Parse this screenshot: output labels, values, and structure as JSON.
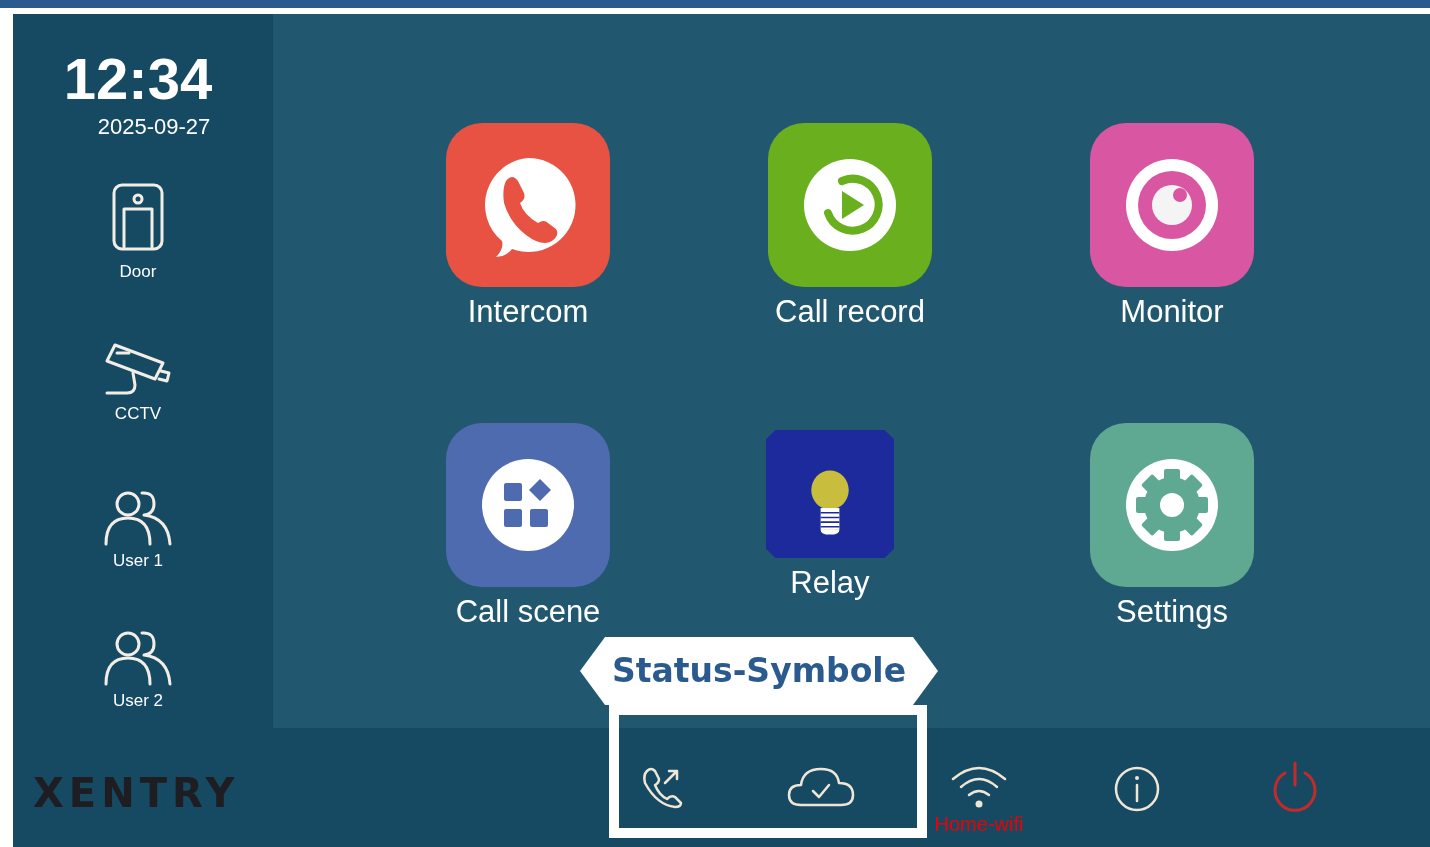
{
  "clock": {
    "time": "12:34",
    "date": "2025-09-27"
  },
  "sidebar": {
    "items": [
      {
        "kind": "door",
        "label": "Door"
      },
      {
        "kind": "cctv",
        "label": "CCTV"
      },
      {
        "kind": "users",
        "label": "User 1"
      },
      {
        "kind": "users",
        "label": "User 2"
      }
    ]
  },
  "apps": [
    {
      "kind": "intercom",
      "label": "Intercom",
      "color": "#e85243"
    },
    {
      "kind": "record",
      "label": "Call record",
      "color": "#6aaf1e"
    },
    {
      "kind": "monitor",
      "label": "Monitor",
      "color": "#d957a2"
    },
    {
      "kind": "scene",
      "label": "Call scene",
      "color": "#4f6bb0"
    },
    {
      "kind": "relay",
      "label": "Relay",
      "color": "#1c2a9b"
    },
    {
      "kind": "settings",
      "label": "Settings",
      "color": "#5fa992"
    }
  ],
  "status_bar": {
    "logo": "XENTRY",
    "items": [
      {
        "kind": "call"
      },
      {
        "kind": "cloud"
      },
      {
        "kind": "wifi",
        "label": "Home-wifi"
      },
      {
        "kind": "info"
      },
      {
        "kind": "power"
      }
    ]
  },
  "annotation": {
    "label": "Status-Symbole"
  }
}
